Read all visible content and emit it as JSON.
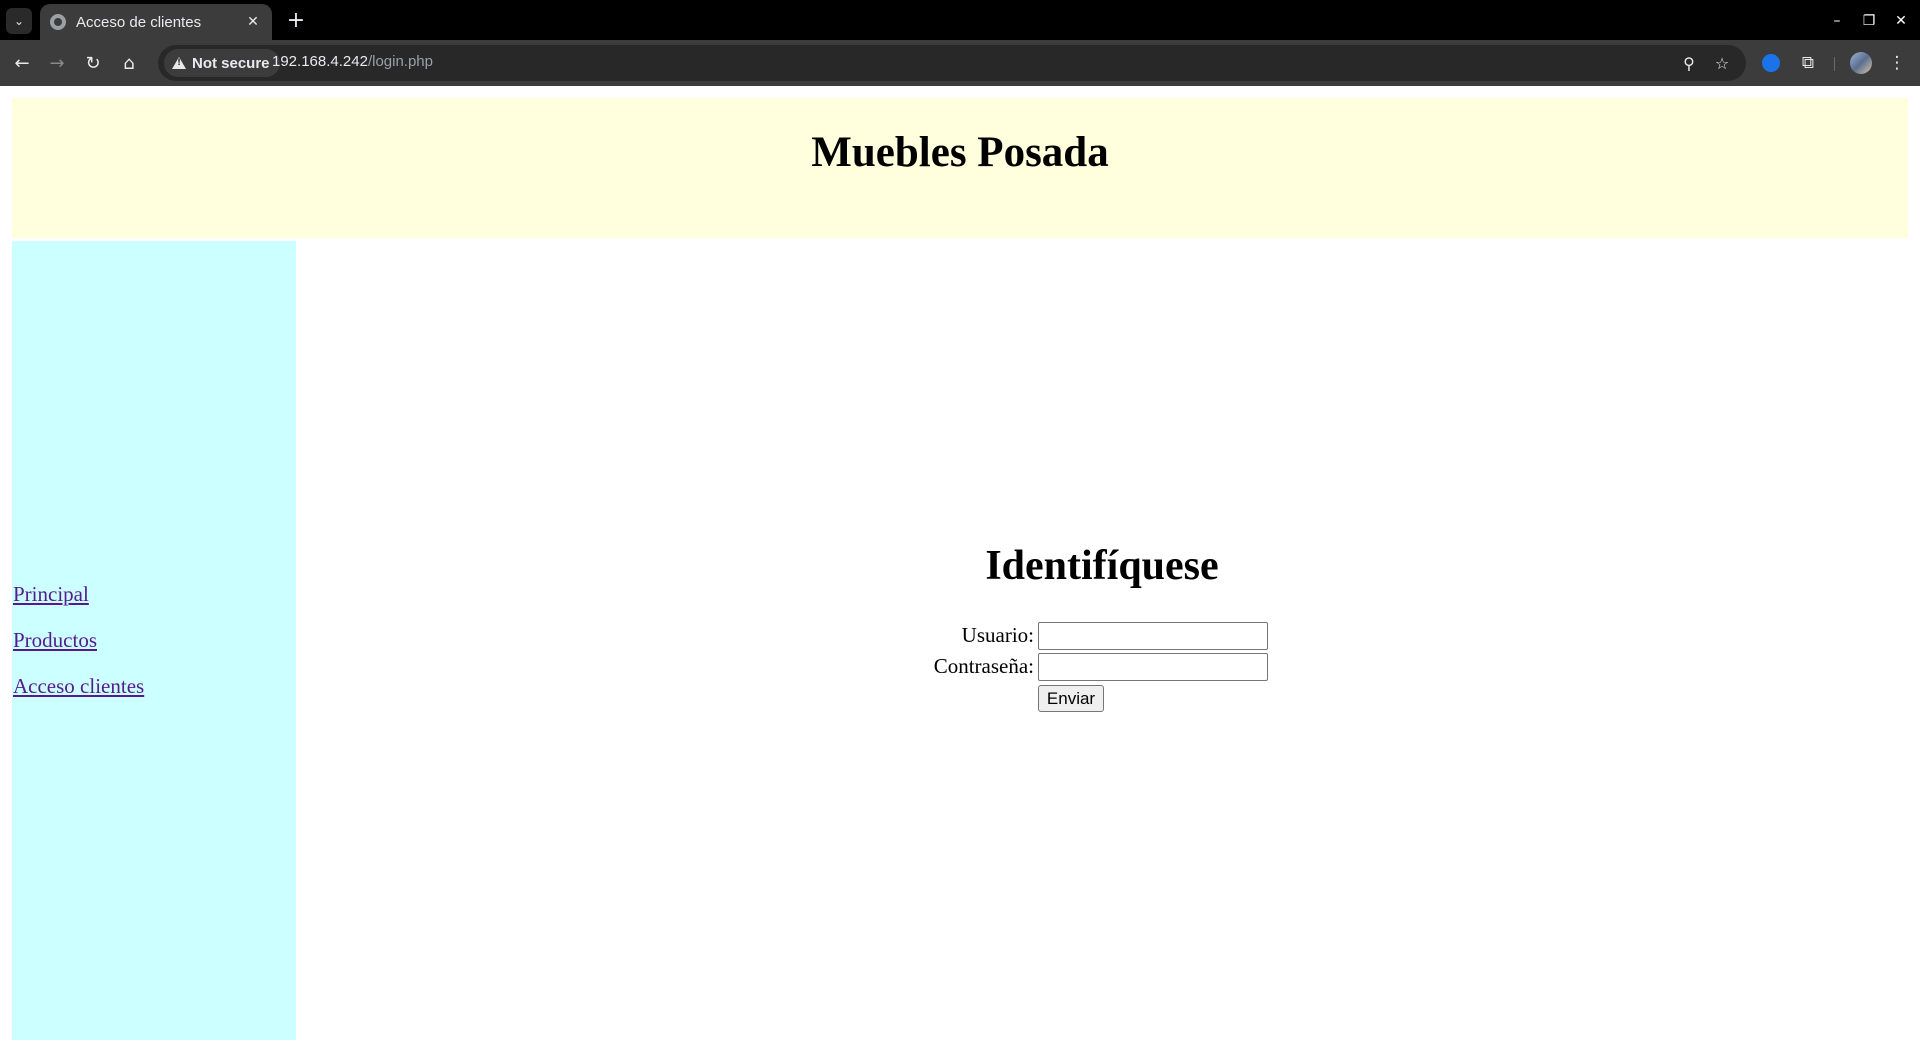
{
  "browser": {
    "tab_menu_icon": "chevron-down-icon",
    "tab_title": "Acceso de clientes",
    "tab_close": "✕",
    "new_tab": "+",
    "security_label": "Not secure",
    "url_host": "192.168.4.242",
    "url_path": "/login.php",
    "window_controls": {
      "minimize": "–",
      "restore": "❐",
      "close": "✕"
    },
    "nav": {
      "back": "←",
      "forward": "→",
      "reload": "↻",
      "home": "⌂"
    },
    "icons": {
      "zoom": "⚲",
      "bookmark": "☆",
      "extensions": "⧉",
      "menu": "⋮"
    }
  },
  "page": {
    "site_title": "Muebles Posada",
    "nav_links": [
      "Principal",
      "Productos",
      "Acceso clientes"
    ],
    "login_heading": "Identifíquese",
    "form": {
      "username_label": "Usuario:",
      "username_value": "",
      "password_label": "Contraseña:",
      "password_value": "",
      "submit_label": "Enviar"
    }
  },
  "colors": {
    "header_bg": "#ffffdd",
    "sidebar_bg": "#ccffff",
    "link_color": "#551a8b",
    "chrome_dark": "#000000",
    "toolbar_bg": "#3c3c3c"
  }
}
